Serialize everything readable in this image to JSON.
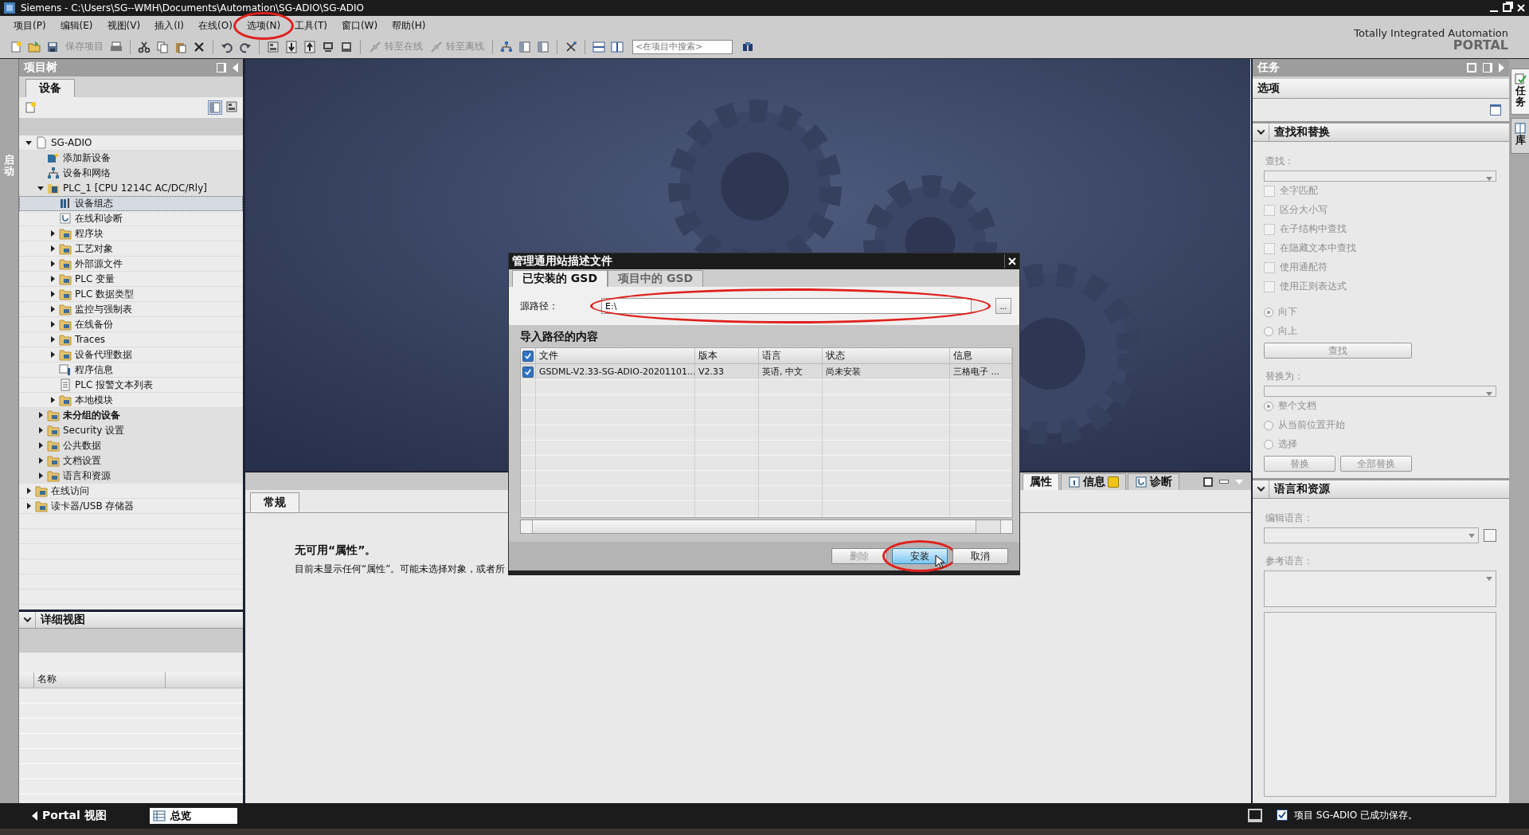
{
  "window": {
    "title": "Siemens  -  C:\\Users\\SG--WMH\\Documents\\Automation\\SG-ADIO\\SG-ADIO"
  },
  "menu": [
    {
      "label": "项目(P)",
      "highlighted": false
    },
    {
      "label": "编辑(E)",
      "highlighted": false
    },
    {
      "label": "视图(V)",
      "highlighted": false
    },
    {
      "label": "插入(I)",
      "highlighted": false
    },
    {
      "label": "在线(O)",
      "highlighted": false
    },
    {
      "label": "选项(N)",
      "highlighted": true
    },
    {
      "label": "工具(T)",
      "highlighted": false
    },
    {
      "label": "窗口(W)",
      "highlighted": false
    },
    {
      "label": "帮助(H)",
      "highlighted": false
    }
  ],
  "toolbar": {
    "buttons": [
      {
        "label": "保存项目",
        "kind": "plain",
        "disabled": true
      },
      {
        "label": "转至在线",
        "kind": "online",
        "disabled": true
      },
      {
        "label": "转至离线",
        "kind": "offline",
        "disabled": true
      }
    ],
    "search": {
      "placeholder": "<在项目中搜索>"
    }
  },
  "branding": {
    "line_1": "Totally Integrated Automation",
    "line_2": "PORTAL"
  },
  "start_strip": {
    "label": "启动"
  },
  "project_tree": {
    "title": "项目树",
    "tab": "设备",
    "nodes": [
      {
        "label": "SG-ADIO",
        "kind": "project",
        "expanded": true,
        "selected": false,
        "bold": false,
        "children": [
          {
            "label": "添加新设备",
            "kind": "add",
            "selected": false,
            "bold": false
          },
          {
            "label": "设备和网络",
            "kind": "network",
            "selected": false,
            "bold": false
          },
          {
            "label": "PLC_1 [CPU 1214C AC/DC/Rly]",
            "kind": "plc",
            "expanded": true,
            "selected": false,
            "bold": false,
            "children": [
              {
                "label": "设备组态",
                "kind": "config",
                "selected": true,
                "bold": false
              },
              {
                "label": "在线和诊断",
                "kind": "diag",
                "selected": false,
                "bold": false
              },
              {
                "label": "程序块",
                "kind": "folder",
                "expanded": false,
                "selected": false,
                "bold": false
              },
              {
                "label": "工艺对象",
                "kind": "folder",
                "expanded": false,
                "selected": false,
                "bold": false
              },
              {
                "label": "外部源文件",
                "kind": "folder",
                "expanded": false,
                "selected": false,
                "bold": false
              },
              {
                "label": "PLC 变量",
                "kind": "folder",
                "expanded": false,
                "selected": false,
                "bold": false
              },
              {
                "label": "PLC 数据类型",
                "kind": "folder",
                "expanded": false,
                "selected": false,
                "bold": false
              },
              {
                "label": "监控与强制表",
                "kind": "folder",
                "expanded": false,
                "selected": false,
                "bold": false
              },
              {
                "label": "在线备份",
                "kind": "folder",
                "expanded": false,
                "selected": false,
                "bold": false
              },
              {
                "label": "Traces",
                "kind": "folder",
                "expanded": false,
                "selected": false,
                "bold": false
              },
              {
                "label": "设备代理数据",
                "kind": "folder",
                "expanded": false,
                "selected": false,
                "bold": false
              },
              {
                "label": "程序信息",
                "kind": "info",
                "selected": false,
                "bold": false
              },
              {
                "label": "PLC 报警文本列表",
                "kind": "list",
                "selected": false,
                "bold": false
              },
              {
                "label": "本地模块",
                "kind": "folder",
                "expanded": false,
                "selected": false,
                "bold": false
              }
            ]
          },
          {
            "label": "未分组的设备",
            "kind": "folder",
            "expanded": false,
            "selected": false,
            "bold": true
          },
          {
            "label": "Security 设置",
            "kind": "folder",
            "expanded": false,
            "selected": false,
            "bold": false
          },
          {
            "label": "公共数据",
            "kind": "folder",
            "expanded": false,
            "selected": false,
            "bold": false
          },
          {
            "label": "文档设置",
            "kind": "folder",
            "expanded": false,
            "selected": false,
            "bold": false
          },
          {
            "label": "语言和资源",
            "kind": "folder",
            "expanded": false,
            "selected": false,
            "bold": false
          }
        ]
      },
      {
        "label": "在线访问",
        "kind": "folder",
        "expanded": false,
        "selected": false,
        "bold": false
      },
      {
        "label": "读卡器/USB 存储器",
        "kind": "folder",
        "expanded": false,
        "selected": false,
        "bold": false
      }
    ]
  },
  "details_view": {
    "title": "详细视图",
    "expanded": true,
    "columns": [
      "名称"
    ]
  },
  "inspector": {
    "tabs": [
      {
        "label": "属性",
        "selected": true
      },
      {
        "label": "信息",
        "selected": false
      },
      {
        "label": "诊断",
        "selected": false
      }
    ],
    "subtabs": [
      {
        "label": "常规",
        "selected": true
      }
    ],
    "message_title": "无可用“属性”。",
    "message_text": "目前未显示任何“属性”。可能未选择对象，或者所"
  },
  "dialog": {
    "title": "管理通用站描述文件",
    "tabs": [
      {
        "label": "已安装的 GSD",
        "selected": true
      },
      {
        "label": "项目中的 GSD",
        "selected": false
      }
    ],
    "source_label": "源路径：",
    "source_value": "E:\\",
    "source_highlighted": true,
    "browse_label": "...",
    "section_title": "导入路径的内容",
    "table": {
      "select_all_checked": true,
      "columns": [
        "文件",
        "版本",
        "语言",
        "状态",
        "信息"
      ],
      "rows": [
        {
          "checked": true,
          "cells": [
            "GSDML-V2.33-SG-ADIO-20201101...",
            "V2.33",
            "英语, 中文",
            "尚未安装",
            "三格电子 ..."
          ]
        }
      ]
    },
    "buttons": [
      {
        "label": "删除",
        "disabled": true,
        "default": false,
        "highlighted": false
      },
      {
        "label": "安装",
        "disabled": false,
        "default": true,
        "highlighted": true
      },
      {
        "label": "取消",
        "disabled": false,
        "default": false,
        "highlighted": false
      }
    ]
  },
  "task_panel": {
    "title": "任务",
    "subtitle": "选项",
    "find_replace": {
      "title": "查找和替换",
      "expanded": true,
      "find_label": "查找：",
      "options": [
        {
          "label": "全字匹配",
          "checked": false,
          "disabled": true
        },
        {
          "label": "区分大小写",
          "checked": false,
          "disabled": true
        },
        {
          "label": "在子结构中查找",
          "checked": false,
          "disabled": true
        },
        {
          "label": "在隐藏文本中查找",
          "checked": false,
          "disabled": true
        },
        {
          "label": "使用通配符",
          "checked": false,
          "disabled": true
        },
        {
          "label": "使用正则表达式",
          "checked": false,
          "disabled": true
        }
      ],
      "directions": [
        {
          "label": "向下",
          "selected": true
        },
        {
          "label": "向上",
          "selected": false
        }
      ],
      "find_button": "查找",
      "replace_label": "替换为：",
      "scopes": [
        {
          "label": "整个文档",
          "selected": true
        },
        {
          "label": "从当前位置开始",
          "selected": false
        },
        {
          "label": "选择",
          "selected": false
        }
      ],
      "replace_buttons": [
        "替换",
        "全部替换"
      ]
    },
    "language": {
      "title": "语言和资源",
      "expanded": true,
      "edit_label": "编辑语言：",
      "reference_label": "参考语言："
    }
  },
  "side_tabs": [
    {
      "label": "任务",
      "selected": true
    },
    {
      "label": "库",
      "selected": false
    }
  ],
  "status_bar": {
    "portal_button": "Portal 视图",
    "overview_tab": "总览",
    "message": "项目 SG-ADIO 已成功保存。"
  }
}
